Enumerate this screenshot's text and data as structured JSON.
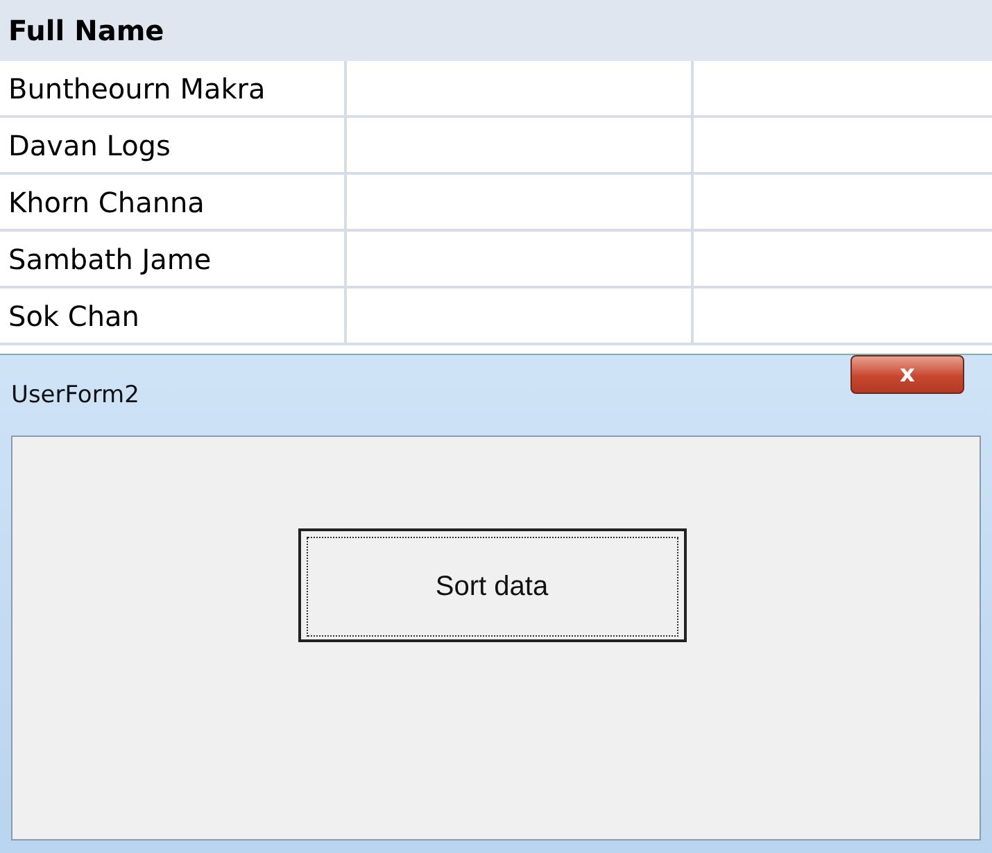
{
  "sheet": {
    "header": "Full Name",
    "rows": [
      "Buntheourn Makra",
      "Davan Logs",
      "Khorn Channa",
      "Sambath Jame",
      "Sok Chan"
    ]
  },
  "dialog": {
    "title": "UserForm2",
    "close": "x",
    "button": {
      "label": "Sort data",
      "focused": true
    }
  }
}
